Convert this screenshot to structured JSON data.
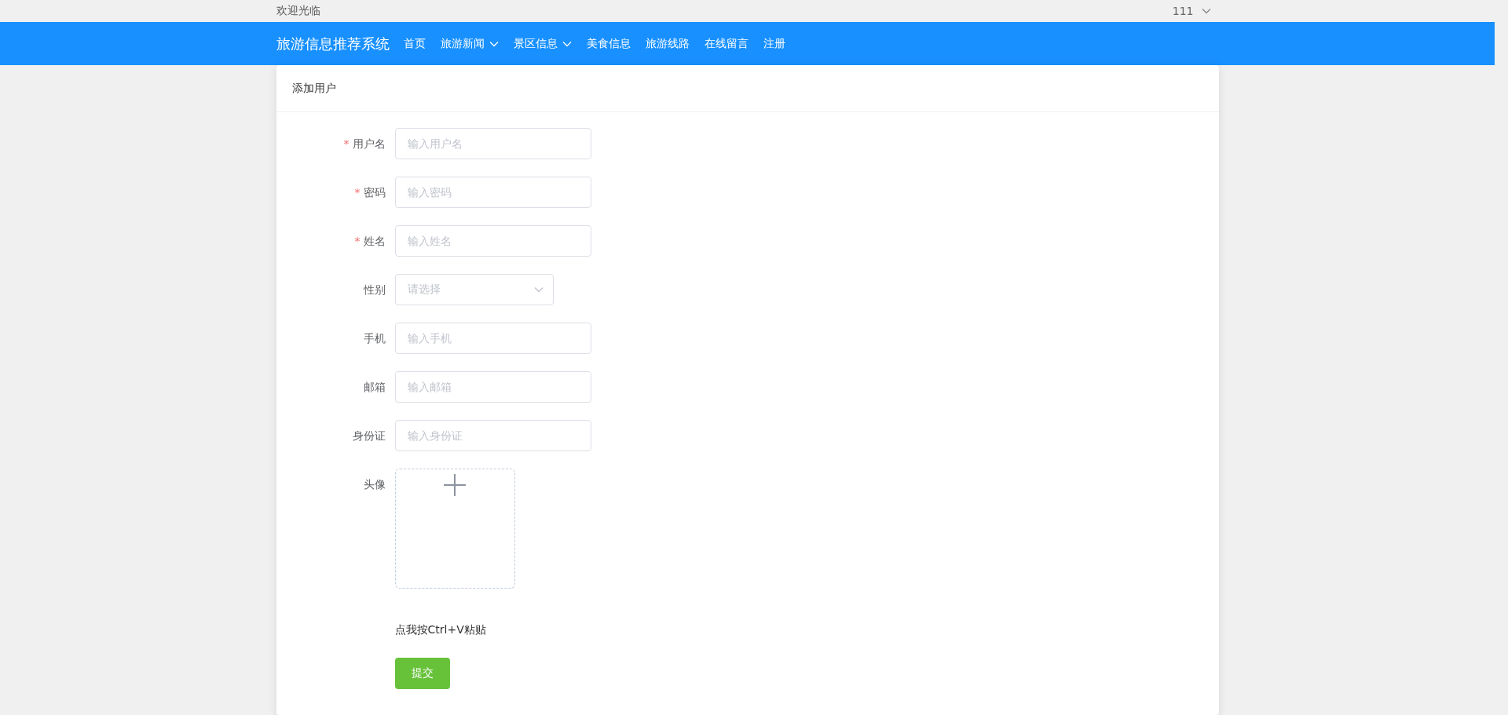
{
  "top_bar": {
    "welcome": "欢迎光临",
    "user": "111"
  },
  "nav": {
    "brand": "旅游信息推荐系统",
    "items": [
      {
        "label": "首页",
        "dropdown": false
      },
      {
        "label": "旅游新闻",
        "dropdown": true
      },
      {
        "label": "景区信息",
        "dropdown": true
      },
      {
        "label": "美食信息",
        "dropdown": false
      },
      {
        "label": "旅游线路",
        "dropdown": false
      },
      {
        "label": "在线留言",
        "dropdown": false
      },
      {
        "label": "注册",
        "dropdown": false
      }
    ]
  },
  "card": {
    "title": "添加用户",
    "fields": [
      {
        "kind": "input",
        "label": "用户名",
        "required_mark": "*",
        "placeholder": "输入用户名"
      },
      {
        "kind": "input",
        "label": "密码",
        "required_mark": "*",
        "placeholder": "输入密码"
      },
      {
        "kind": "input",
        "label": "姓名",
        "required_mark": "*",
        "placeholder": "输入姓名"
      },
      {
        "kind": "select",
        "label": "性别",
        "placeholder": "请选择"
      },
      {
        "kind": "input",
        "label": "手机",
        "placeholder": "输入手机"
      },
      {
        "kind": "input",
        "label": "邮箱",
        "placeholder": "输入邮箱"
      },
      {
        "kind": "input",
        "label": "身份证",
        "placeholder": "输入身份证"
      },
      {
        "kind": "upload",
        "label": "头像",
        "hint": "点我按Ctrl+V粘贴"
      }
    ],
    "submit": "提交"
  }
}
